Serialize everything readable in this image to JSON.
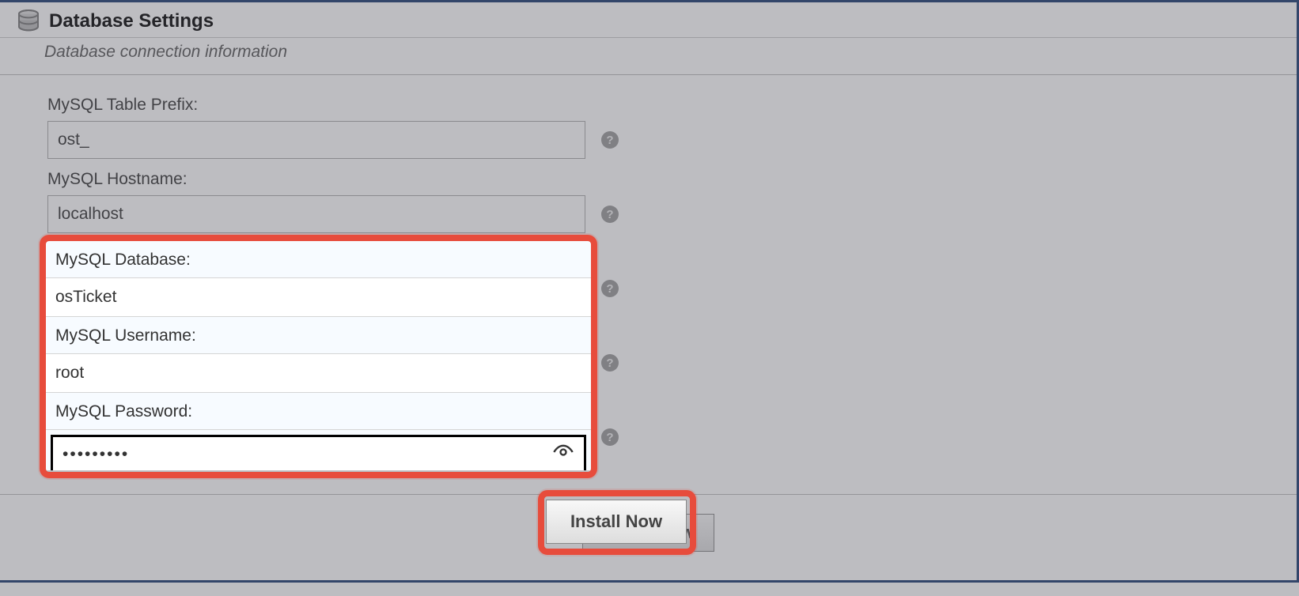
{
  "section": {
    "title": "Database Settings",
    "subtitle": "Database connection information"
  },
  "fields": {
    "prefix": {
      "label": "MySQL Table Prefix:",
      "value": "ost_"
    },
    "hostname": {
      "label": "MySQL Hostname:",
      "value": "localhost"
    },
    "database": {
      "label": "MySQL Database:",
      "value": "osTicket"
    },
    "username": {
      "label": "MySQL Username:",
      "value": "root"
    },
    "password": {
      "label": "MySQL Password:",
      "value": "•••••••••"
    }
  },
  "help_glyph": "?",
  "buttons": {
    "install": "Install Now"
  }
}
